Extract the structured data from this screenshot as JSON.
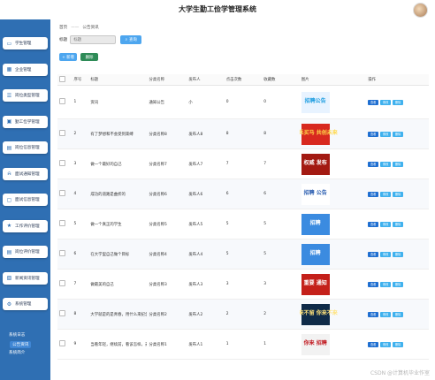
{
  "header": {
    "title": "大学生勤工俭学管理系统"
  },
  "sidebar": {
    "items": [
      {
        "label": "学生管理",
        "icon": "user-icon"
      },
      {
        "label": "企业管理",
        "icon": "building-icon"
      },
      {
        "label": "岗位类型管理",
        "icon": "list-icon"
      },
      {
        "label": "勤工俭学管理",
        "icon": "briefcase-icon"
      },
      {
        "label": "岗位信息管理",
        "icon": "document-icon"
      },
      {
        "label": "面试通知管理",
        "icon": "bell-icon"
      },
      {
        "label": "面试信息管理",
        "icon": "chat-icon"
      },
      {
        "label": "工作评价管理",
        "icon": "star-icon"
      },
      {
        "label": "岗位评价管理",
        "icon": "comment-icon"
      },
      {
        "label": "新闻资讯管理",
        "icon": "news-icon"
      },
      {
        "label": "系统管理",
        "icon": "gear-icon"
      }
    ],
    "sub_items": [
      "系统日志",
      "公告资讯",
      "系统简介"
    ],
    "active_sub": "公告资讯"
  },
  "breadcrumb": {
    "home": "首页",
    "separator": "——",
    "current": "公告资讯"
  },
  "search": {
    "label": "标题",
    "placeholder": "标题",
    "button": "查询"
  },
  "actions": {
    "add": "+ 新增",
    "delete": "删除"
  },
  "table": {
    "headers": [
      "序号",
      "标题",
      "分类名称",
      "发布人",
      "点击次数",
      "收藏数",
      "图片",
      "操作"
    ],
    "rows": [
      {
        "no": "1",
        "title": "资讯",
        "category": "通知公告",
        "publisher": "小",
        "clicks": "0",
        "favorites": "0",
        "image": {
          "text": "招聘公告",
          "bg": "#e8f3ff",
          "fg": "#1d9de0"
        }
      },
      {
        "no": "2",
        "title": "有了梦想和不会受到束缚",
        "category": "分类名称8",
        "publisher": "发布人8",
        "clicks": "8",
        "favorites": "8",
        "image": {
          "text": "招兵买马 共创未来",
          "bg": "#d8291f",
          "fg": "#ffd84a"
        }
      },
      {
        "no": "3",
        "title": "做一个最好的自己",
        "category": "分类名称7",
        "publisher": "发布人7",
        "clicks": "7",
        "favorites": "7",
        "image": {
          "text": "权威 发布",
          "bg": "#a31a12",
          "fg": "#ffffff"
        }
      },
      {
        "no": "4",
        "title": "成功的道路是曲折的",
        "category": "分类名称6",
        "publisher": "发布人6",
        "clicks": "6",
        "favorites": "6",
        "image": {
          "text": "招聘 公告",
          "bg": "#ffffff",
          "fg": "#2a5db0"
        }
      },
      {
        "no": "5",
        "title": "做一个真正的学生",
        "category": "分类名称5",
        "publisher": "发布人5",
        "clicks": "5",
        "favorites": "5",
        "image": {
          "text": "招聘",
          "bg": "#3b8be0",
          "fg": "#ffffff"
        }
      },
      {
        "no": "6",
        "title": "在大学里自己做个目标",
        "category": "分类名称4",
        "publisher": "发布人4",
        "clicks": "5",
        "favorites": "5",
        "image": {
          "text": "招聘",
          "bg": "#3b8be0",
          "fg": "#ffffff"
        }
      },
      {
        "no": "7",
        "title": "做最美的自己",
        "category": "分类名称3",
        "publisher": "发布人3",
        "clicks": "3",
        "favorites": "3",
        "image": {
          "text": "重要 通知",
          "bg": "#c4201a",
          "fg": "#ffffff"
        }
      },
      {
        "no": "8",
        "title": "大学就是的是青春，用什么来纪念",
        "category": "分类名称2",
        "publisher": "发布人2",
        "clicks": "2",
        "favorites": "2",
        "image": {
          "text": "未来不留 你来不来",
          "bg": "#0f2b48",
          "fg": "#ffe27a"
        }
      },
      {
        "no": "9",
        "title": "当看年轻，继续前，看该怎样，去追求",
        "category": "分类名称1",
        "publisher": "发布人1",
        "clicks": "1",
        "favorites": "1",
        "image": {
          "text": "你来 招聘",
          "bg": "#f2f2f2",
          "fg": "#c0161d"
        }
      }
    ],
    "row_actions": [
      "查看",
      "修改",
      "删除"
    ]
  },
  "watermark": "CSDN @计算机毕业作室"
}
